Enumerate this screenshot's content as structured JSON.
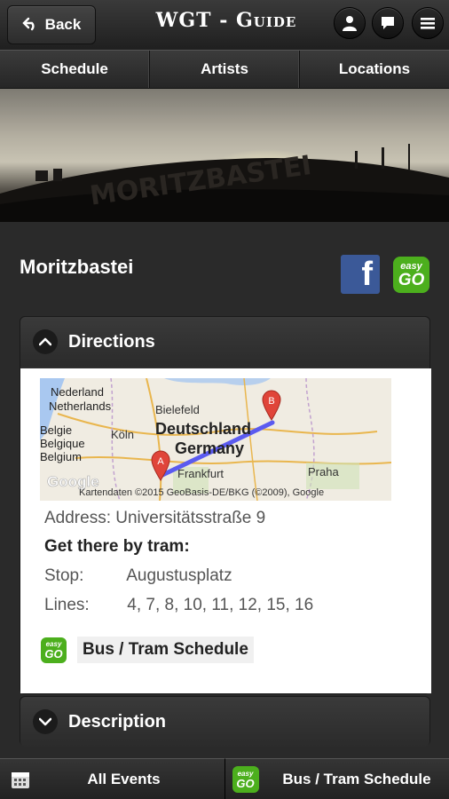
{
  "header": {
    "back_label": "Back",
    "app_title": "WGT - Guide"
  },
  "tabs": [
    {
      "label": "Schedule"
    },
    {
      "label": "Artists"
    },
    {
      "label": "Locations"
    }
  ],
  "hero": {
    "photo_text": "MORITZBASTEI"
  },
  "venue": {
    "name": "Moritzbastei"
  },
  "directions": {
    "title": "Directions",
    "map": {
      "labels": [
        "Nederland",
        "Netherlands",
        "Bielefeld",
        "Belgie",
        "Belgique",
        "Belgium",
        "Köln",
        "Deutschland",
        "Germany",
        "Frankfurt",
        "Praha",
        "Google"
      ],
      "marker_a": "A",
      "marker_b": "B",
      "attribution": "Kartendaten ©2015 GeoBasis-DE/BKG (©2009), Google"
    },
    "address_label": "Address:",
    "address_value": "Universitätsstraße 9",
    "tram_heading": "Get there by tram:",
    "stop_label": "Stop:",
    "stop_value": "Augustusplatz",
    "lines_label": "Lines:",
    "lines_value": "4, 7, 8, 10, 11, 12, 15, 16",
    "bus_link": "Bus / Tram Schedule"
  },
  "description": {
    "title": "Description"
  },
  "easygo": {
    "line1": "easy",
    "line2": "GO"
  },
  "footer": {
    "all_events": "All Events",
    "bus_schedule": "Bus / Tram Schedule"
  },
  "colors": {
    "background": "#2a2a2a",
    "facebook": "#3b5998",
    "easygo": "#4caf1d",
    "route": "#5b5bf0",
    "marker": "#e0453a"
  }
}
